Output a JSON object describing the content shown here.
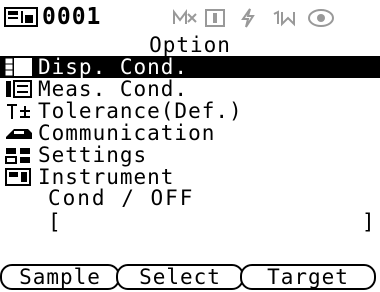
{
  "status": {
    "sample_number": "0001",
    "icons": [
      "sample-data-icon",
      "m-measure-icon",
      "instrument-status-icon",
      "power-icon",
      "measure-mode-icon",
      "light-source-icon"
    ]
  },
  "screen_title": "Option",
  "menu": [
    {
      "label": "Disp. Cond.",
      "icon": "display-condition-icon",
      "selected": true
    },
    {
      "label": "Meas. Cond.",
      "icon": "measurement-condition-icon",
      "selected": false
    },
    {
      "label": "Tolerance(Def.)",
      "icon": "tolerance-icon",
      "selected": false
    },
    {
      "label": "Communication",
      "icon": "communication-icon",
      "selected": false
    },
    {
      "label": "Settings",
      "icon": "settings-icon",
      "selected": false
    },
    {
      "label": "Instrument",
      "icon": "instrument-icon",
      "selected": false
    }
  ],
  "info": {
    "cond_label": "Cond / OFF",
    "bracket_left": "[",
    "bracket_right": "]"
  },
  "softkeys": [
    "Sample",
    "Select",
    "Target"
  ]
}
